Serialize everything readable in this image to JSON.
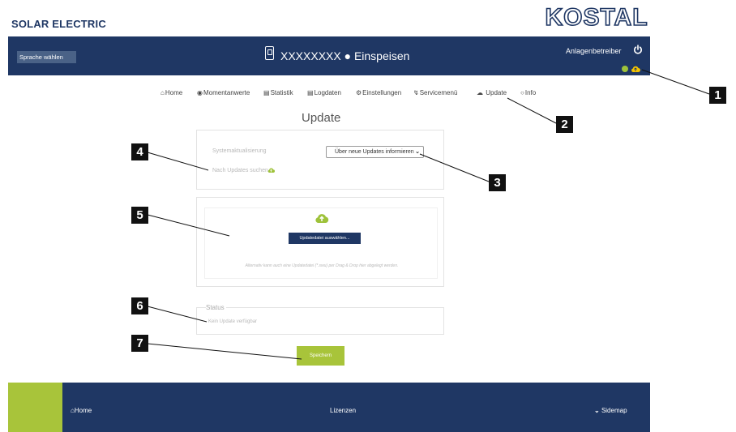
{
  "brand": {
    "company": "SOLAR ELECTRIC",
    "logo": "KOSTAL"
  },
  "header": {
    "language_button": "Sprache wählen",
    "device_title": "XXXXXXXX ● Einspeisen",
    "operator": "Anlagenbetreiber",
    "icons": [
      "device-icon",
      "power-icon",
      "status-globe-icon",
      "update-cloud-icon"
    ]
  },
  "nav": [
    {
      "label": "Home",
      "icon": "home-icon"
    },
    {
      "label": "Momentanwerte",
      "icon": "gauge-icon"
    },
    {
      "label": "Statistik",
      "icon": "chart-icon"
    },
    {
      "label": "Logdaten",
      "icon": "document-icon"
    },
    {
      "label": "Einstellungen",
      "icon": "gear-icon"
    },
    {
      "label": "Servicemenü",
      "icon": "bolt-icon"
    },
    {
      "label": "Update",
      "icon": "cloud-icon"
    },
    {
      "label": "Info",
      "icon": "bulb-icon"
    }
  ],
  "page": {
    "title": "Update"
  },
  "system_update": {
    "label": "Systemaktualisierung",
    "selected_option": "Über neue Updates informieren",
    "search_link": "Nach Updates suchen"
  },
  "file_upload": {
    "button": "Updatedatei auswählen...",
    "hint": "Alternativ kann auch eine Updatedatei (*.swu) per Drag & Drop hier abgelegt werden."
  },
  "status": {
    "title": "Status",
    "text": "Kein Update verfügbar"
  },
  "save_button": "Speichern",
  "footer": {
    "home": "Home",
    "licenses": "Lizenzen",
    "sitemap": "Sidemap"
  },
  "callouts": [
    "1",
    "2",
    "3",
    "4",
    "5",
    "6",
    "7"
  ],
  "colors": {
    "navy": "#1f3764",
    "green": "#a8c43a",
    "yellow": "#f2c200"
  }
}
